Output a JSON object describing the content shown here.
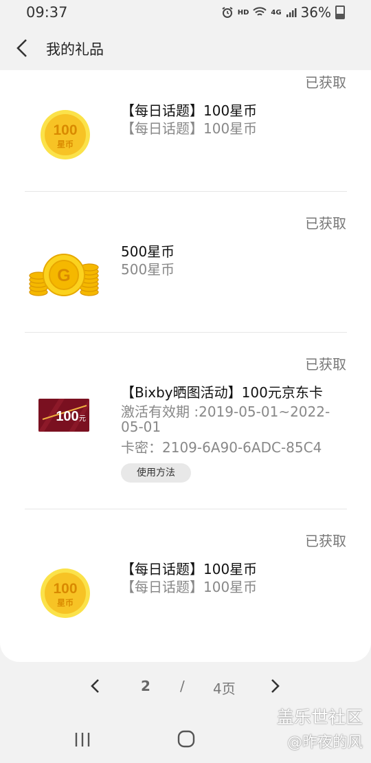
{
  "status_bar": {
    "time": "09:37",
    "hd": "HD",
    "network": "4G",
    "battery": "36%"
  },
  "header": {
    "title": "我的礼品"
  },
  "gifts": [
    {
      "status": "已获取",
      "title": "【每日话题】100星币",
      "subtitle": "【每日话题】100星币",
      "icon_text": "100",
      "icon_sub": "星币"
    },
    {
      "status": "已获取",
      "title": "500星币",
      "subtitle": "500星币",
      "icon_letter": "G"
    },
    {
      "status": "已获取",
      "title": "【Bixby晒图活动】100元京东卡",
      "validity_line1": "激活有效期 :2019-05-01~2022-",
      "validity_line2": "05-01",
      "card_code": "卡密：2109-6A90-6ADC-85C4",
      "usage_label": "使用方法",
      "icon_text": "100",
      "icon_unit": "元"
    },
    {
      "status": "已获取",
      "title": "【每日话题】100星币",
      "subtitle": "【每日话题】100星币",
      "icon_text": "100",
      "icon_sub": "星币"
    }
  ],
  "pager": {
    "current": "2",
    "separator": "/",
    "total": "4页"
  },
  "watermark": {
    "line1": "盖乐世社区",
    "line2": "@昨夜的风"
  },
  "colors": {
    "coin_gold": "#f7c325",
    "coin_text": "#d98a00",
    "card_red": "#7a1020"
  }
}
